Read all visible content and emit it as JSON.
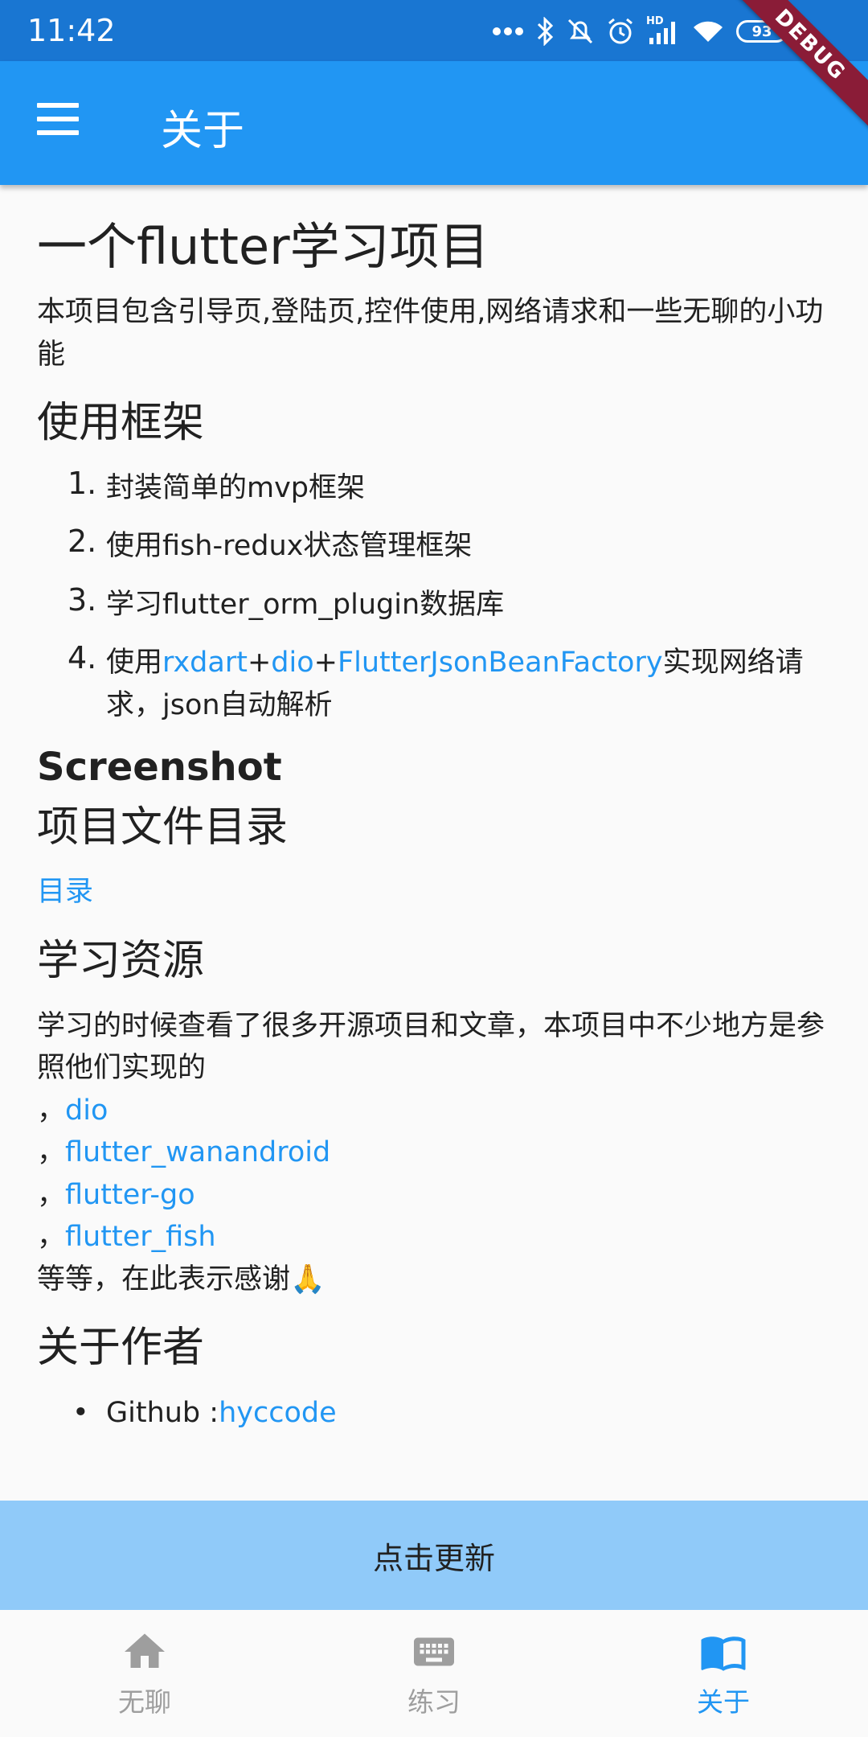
{
  "status_bar": {
    "time": "11:42",
    "battery": "93",
    "icons": [
      "more-dots-icon",
      "bluetooth-icon",
      "bell-off-icon",
      "alarm-icon",
      "signal-icon",
      "wifi-icon",
      "battery-icon"
    ],
    "hd_label": "HD"
  },
  "debug_banner": "DEBUG",
  "app_bar": {
    "title": "关于",
    "menu_icon": "menu-icon"
  },
  "content": {
    "title": "一个flutter学习项目",
    "intro": "本项目包含引导页,登陆页,控件使用,网络请求和一些无聊的小功能",
    "framework_heading": "使用框架",
    "framework_items": [
      {
        "num": "1.",
        "text": "封装简单的mvp框架"
      },
      {
        "num": "2.",
        "text": "使用fish-redux状态管理框架"
      },
      {
        "num": "3.",
        "text": "学习flutter_orm_plugin数据库"
      },
      {
        "num": "4.",
        "prefix": "使用",
        "link1": "rxdart",
        "plus1": "+",
        "link2": "dio",
        "plus2": "+",
        "link3": "FlutterJsonBeanFactory",
        "suffix": "实现网络请求，json自动解析"
      }
    ],
    "screenshot_heading": "Screenshot",
    "files_heading": "项目文件目录",
    "files_link": "目录",
    "resources_heading": "学习资源",
    "resources_text": " 学习的时候查看了很多开源项目和文章，本项目中不少地方是参照他们实现的",
    "resources_separator": "，",
    "resources_links": [
      "dio",
      "flutter_wanandroid",
      "flutter-go",
      "flutter_fish"
    ],
    "thanks_text": " 等等，在此表示感谢🙏",
    "author_heading": "关于作者",
    "author_label": "Github :",
    "author_link": "hyccode"
  },
  "update_button": "点击更新",
  "bottom_nav": [
    {
      "label": "无聊",
      "icon": "home-icon",
      "active": false
    },
    {
      "label": "练习",
      "icon": "keyboard-icon",
      "active": false
    },
    {
      "label": "关于",
      "icon": "book-icon",
      "active": true
    }
  ],
  "colors": {
    "primary": "#2196f3",
    "primary_dark": "#1976d2",
    "button_bg": "#90caf9",
    "debug": "#8a1c37"
  }
}
